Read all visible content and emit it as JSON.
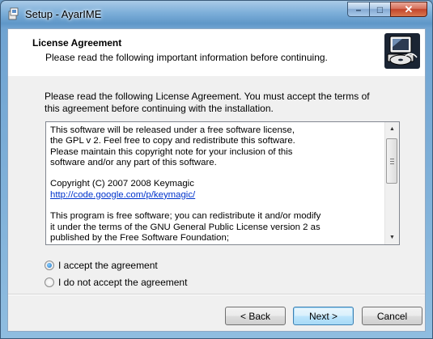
{
  "window": {
    "title": "Setup - AyarIME",
    "caption": {
      "minimize": "–",
      "maximize": "□",
      "close": "✕"
    }
  },
  "header": {
    "title": "License Agreement",
    "subtitle": "Please read the following important information before continuing.",
    "logo_icon": "setup-computer-cd-icon"
  },
  "intro": "Please read the following License Agreement. You must accept the terms of this agreement before continuing with the installation.",
  "license": {
    "lines_before_link": "This software will be released under a free software license,\nthe GPL v 2. Feel free to copy and redistribute this software.\nPlease maintain this copyright note for your inclusion of this\nsoftware and/or any part of this software.\n\nCopyright (C) 2007 2008 Keymagic\n",
    "link": "http://code.google.com/p/keymagic/",
    "lines_after_link": "\n\nThis program is free software; you can redistribute it and/or modify\nit under the terms of the GNU General Public License version 2 as\npublished by the Free Software Foundation;"
  },
  "options": {
    "accept": "I accept the agreement",
    "decline": "I do not accept the agreement",
    "selected": "accept"
  },
  "buttons": {
    "back": "< Back",
    "next": "Next >",
    "cancel": "Cancel"
  },
  "colors": {
    "accent_link": "#0033cc",
    "title_bar": "#7fb0da",
    "close_button": "#c3452c"
  }
}
